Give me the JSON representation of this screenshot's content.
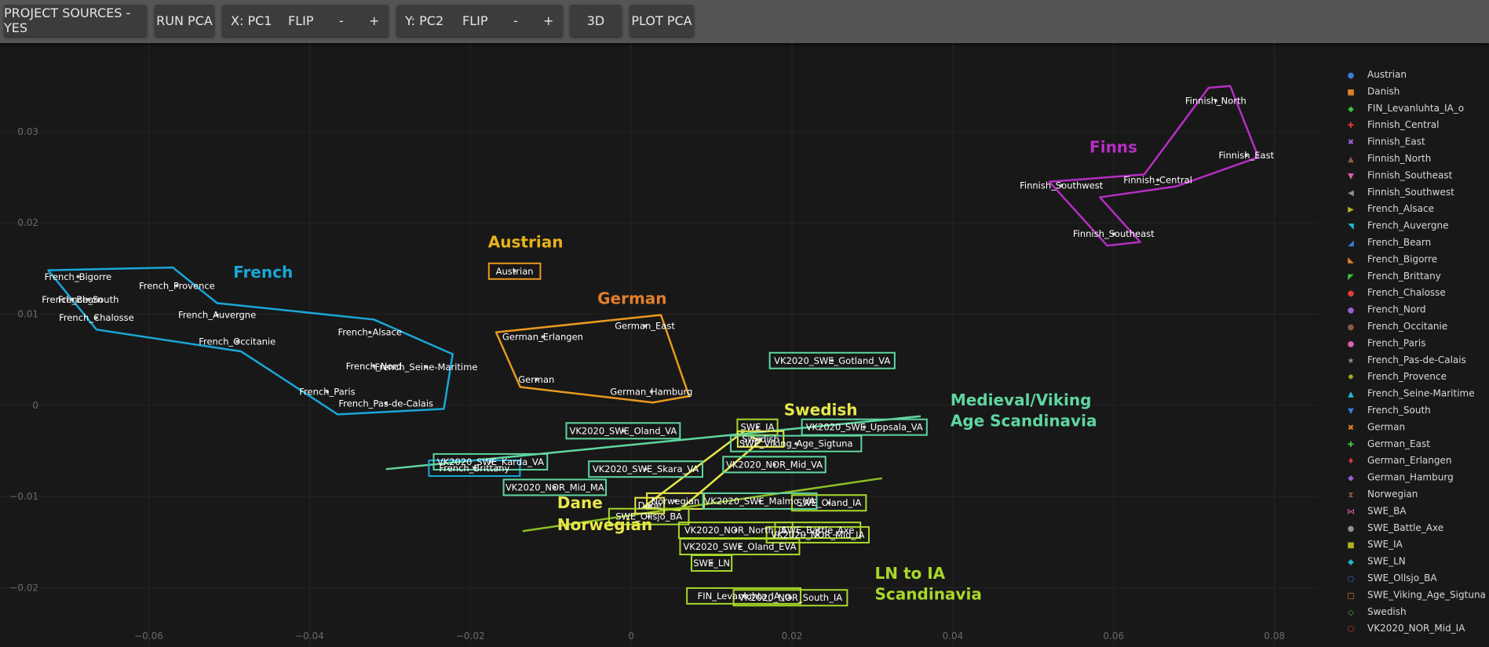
{
  "toolbar": {
    "project_sources": "PROJECT SOURCES - YES",
    "run_pca": "RUN PCA",
    "x_axis": {
      "label": "X: PC1",
      "flip": "FLIP",
      "minus": "-",
      "plus": "+"
    },
    "y_axis": {
      "label": "Y: PC2",
      "flip": "FLIP",
      "minus": "-",
      "plus": "+"
    },
    "three_d": "3D",
    "plot_pca": "PLOT PCA"
  },
  "chart_data": {
    "type": "scatter",
    "xlabel": "",
    "ylabel": "",
    "xlim": [
      -0.0785,
      0.0855
    ],
    "ylim": [
      -0.0265,
      0.0397
    ],
    "xticks": [
      -0.06,
      -0.04,
      -0.02,
      0,
      0.02,
      0.04,
      0.06,
      0.08
    ],
    "xtick_labels": [
      "−0.06",
      "−0.04",
      "−0.02",
      "0",
      "0.02",
      "0.04",
      "0.06",
      "0.08"
    ],
    "yticks": [
      0.03,
      0.02,
      0.01,
      0,
      -0.01,
      -0.02
    ],
    "ytick_labels": [
      "0.03",
      "0.02",
      "0.01",
      "0",
      "−0.01",
      "−0.02"
    ],
    "grid": true,
    "points": [
      {
        "name": "French_Bigorre",
        "x": -0.0688,
        "y": 0.0141
      },
      {
        "name": "French_South",
        "x": -0.0675,
        "y": 0.0116
      },
      {
        "name": "French_Bearn",
        "x": -0.0695,
        "y": 0.0116
      },
      {
        "name": "French_Chalosse",
        "x": -0.0665,
        "y": 0.0096
      },
      {
        "name": "French_Provence",
        "x": -0.0565,
        "y": 0.0131
      },
      {
        "name": "French_Auvergne",
        "x": -0.0515,
        "y": 0.0099
      },
      {
        "name": "French_Occitanie",
        "x": -0.049,
        "y": 0.007
      },
      {
        "name": "French_Alsace",
        "x": -0.0325,
        "y": 0.008
      },
      {
        "name": "French_Nord",
        "x": -0.032,
        "y": 0.0043
      },
      {
        "name": "French_Seine-Maritime",
        "x": -0.0255,
        "y": 0.0042
      },
      {
        "name": "French_Paris",
        "x": -0.0378,
        "y": 0.0015
      },
      {
        "name": "French_Pas-de-Calais",
        "x": -0.0305,
        "y": 0.0002
      },
      {
        "name": "French_Brittany",
        "x": -0.0195,
        "y": -0.0069
      },
      {
        "name": "Austrian",
        "x": -0.0145,
        "y": 0.0147
      },
      {
        "name": "German_Erlangen",
        "x": -0.011,
        "y": 0.0075
      },
      {
        "name": "German_East",
        "x": 0.0017,
        "y": 0.0087
      },
      {
        "name": "German",
        "x": -0.0118,
        "y": 0.0028
      },
      {
        "name": "German_Hamburg",
        "x": 0.0025,
        "y": 0.0015
      },
      {
        "name": "Finnish_North",
        "x": 0.0727,
        "y": 0.0334
      },
      {
        "name": "Finnish_East",
        "x": 0.0765,
        "y": 0.0274
      },
      {
        "name": "Finnish_Central",
        "x": 0.0655,
        "y": 0.0247
      },
      {
        "name": "Finnish_Southwest",
        "x": 0.0535,
        "y": 0.0241
      },
      {
        "name": "Finnish_Southeast",
        "x": 0.06,
        "y": 0.0188
      },
      {
        "name": "VK2020_SWE_Gotland_VA",
        "x": 0.025,
        "y": 0.0049
      },
      {
        "name": "VK2020_SWE_Oland_VA",
        "x": -0.001,
        "y": -0.0028
      },
      {
        "name": "VK2020_SWE_Uppsala_VA",
        "x": 0.029,
        "y": -0.0024
      },
      {
        "name": "SWE_IA",
        "x": 0.0157,
        "y": -0.0024
      },
      {
        "name": "Swedish",
        "x": 0.0161,
        "y": -0.0037
      },
      {
        "name": "SWE_Viking_Age_Sigtuna",
        "x": 0.0205,
        "y": -0.0042
      },
      {
        "name": "VK2020_SWE_Karda_VA",
        "x": -0.0175,
        "y": -0.0062
      },
      {
        "name": "VK2020_SWE_Skara_VA",
        "x": 0.0018,
        "y": -0.007
      },
      {
        "name": "VK2020_NOR_Mid_VA",
        "x": 0.0178,
        "y": -0.0065
      },
      {
        "name": "VK2020_NOR_Mid_MA",
        "x": -0.0095,
        "y": -0.009
      },
      {
        "name": "Dane",
        "x": 0.0023,
        "y": -0.011
      },
      {
        "name": "Norwegian",
        "x": 0.0055,
        "y": -0.0105
      },
      {
        "name": "VK2020_SWE_Malmo_VA",
        "x": 0.016,
        "y": -0.0105
      },
      {
        "name": "SWE_Oland_IA",
        "x": 0.0246,
        "y": -0.0107
      },
      {
        "name": "SWE_Ollsjo_BA",
        "x": 0.0022,
        "y": -0.0122
      },
      {
        "name": "VK2020_NOR_North_IA",
        "x": 0.013,
        "y": -0.0137
      },
      {
        "name": "SWE_Battle_Axe",
        "x": 0.0232,
        "y": -0.0137
      },
      {
        "name": "VK2020_NOR_Mid_IA",
        "x": 0.0232,
        "y": -0.0142
      },
      {
        "name": "VK2020_SWE_Oland_EVA",
        "x": 0.0135,
        "y": -0.0155
      },
      {
        "name": "SWE_LN",
        "x": 0.01,
        "y": -0.0173
      },
      {
        "name": "FIN_Levanluhta_IA_o",
        "x": 0.014,
        "y": -0.0209
      },
      {
        "name": "VK2020_NOR_South_IA",
        "x": 0.0198,
        "y": -0.0211
      }
    ],
    "point_labels": [
      {
        "text": "French_Bigorre",
        "x": -0.0688,
        "y": 0.0141
      },
      {
        "text": "French_South",
        "x": -0.0675,
        "y": 0.0116
      },
      {
        "text": "French_Bearn",
        "x": -0.0695,
        "y": 0.0116
      },
      {
        "text": "French_Chalosse",
        "x": -0.0665,
        "y": 0.0096
      },
      {
        "text": "French_Provence",
        "x": -0.0565,
        "y": 0.0131
      },
      {
        "text": "French_Auvergne",
        "x": -0.0515,
        "y": 0.0099
      },
      {
        "text": "French_Occitanie",
        "x": -0.049,
        "y": 0.007
      },
      {
        "text": "French_Alsace",
        "x": -0.0325,
        "y": 0.008
      },
      {
        "text": "French_Nord",
        "x": -0.032,
        "y": 0.0043
      },
      {
        "text": "French_Seine-Maritime",
        "x": -0.0255,
        "y": 0.0042
      },
      {
        "text": "French_Paris",
        "x": -0.0378,
        "y": 0.0015
      },
      {
        "text": "French_Pas-de-Calais",
        "x": -0.0305,
        "y": 0.0002
      },
      {
        "text": "French_Brittany",
        "x": -0.0195,
        "y": -0.0069,
        "box": "#1aa6d6"
      },
      {
        "text": "Austrian",
        "x": -0.0145,
        "y": 0.0147,
        "box": "#e89a1e"
      },
      {
        "text": "German_Erlangen",
        "x": -0.011,
        "y": 0.0075
      },
      {
        "text": "German_East",
        "x": 0.0017,
        "y": 0.0087
      },
      {
        "text": "German",
        "x": -0.0118,
        "y": 0.0028
      },
      {
        "text": "German_Hamburg",
        "x": 0.0025,
        "y": 0.0015
      },
      {
        "text": "Finnish_North",
        "x": 0.0727,
        "y": 0.0334
      },
      {
        "text": "Finnish_East",
        "x": 0.0765,
        "y": 0.0274
      },
      {
        "text": "Finnish_Central",
        "x": 0.0655,
        "y": 0.0247
      },
      {
        "text": "Finnish_Southwest",
        "x": 0.0535,
        "y": 0.0241
      },
      {
        "text": "Finnish_Southeast",
        "x": 0.06,
        "y": 0.0188
      },
      {
        "text": "VK2020_SWE_Gotland_VA",
        "x": 0.025,
        "y": 0.0049,
        "box": "#5fd6a0"
      },
      {
        "text": "VK2020_SWE_Oland_VA",
        "x": -0.001,
        "y": -0.0028,
        "box": "#5fd6a0"
      },
      {
        "text": "VK2020_SWE_Uppsala_VA",
        "x": 0.029,
        "y": -0.0024,
        "box": "#5fd6a0"
      },
      {
        "text": "SWE_IA",
        "x": 0.0157,
        "y": -0.0024,
        "box": "#a8d82a"
      },
      {
        "text": "Swedish",
        "x": 0.0161,
        "y": -0.0037,
        "box": "#e7e74a"
      },
      {
        "text": "SWE_Viking_Age_Sigtuna",
        "x": 0.0205,
        "y": -0.0042,
        "box": "#5fd6a0"
      },
      {
        "text": "VK2020_SWE_Karda_VA",
        "x": -0.0175,
        "y": -0.0062,
        "box": "#5fd6a0"
      },
      {
        "text": "VK2020_SWE_Skara_VA",
        "x": 0.0018,
        "y": -0.007,
        "box": "#5fd6a0"
      },
      {
        "text": "VK2020_NOR_Mid_VA",
        "x": 0.0178,
        "y": -0.0065,
        "box": "#5fd6a0"
      },
      {
        "text": "VK2020_NOR_Mid_MA",
        "x": -0.0095,
        "y": -0.009,
        "box": "#5fd6a0"
      },
      {
        "text": "Dane",
        "x": 0.0023,
        "y": -0.011,
        "box": "#e7e74a"
      },
      {
        "text": "Norwegian",
        "x": 0.0055,
        "y": -0.0105,
        "box": "#e7e74a"
      },
      {
        "text": "VK2020_SWE_Malmo_VA",
        "x": 0.016,
        "y": -0.0105,
        "box": "#5fd6a0"
      },
      {
        "text": "SWE_Oland_IA",
        "x": 0.0246,
        "y": -0.0107,
        "box": "#a8d82a"
      },
      {
        "text": "SWE_Ollsjo_BA",
        "x": 0.0022,
        "y": -0.0122,
        "box": "#a8d82a"
      },
      {
        "text": "VK2020_NOR_North_IA",
        "x": 0.013,
        "y": -0.0137,
        "box": "#a8d82a"
      },
      {
        "text": "SWE_Battle_Axe",
        "x": 0.0232,
        "y": -0.0137,
        "box": "#a8d82a"
      },
      {
        "text": "VK2020_NOR_Mid_IA",
        "x": 0.0232,
        "y": -0.0142,
        "box": "#a8d82a"
      },
      {
        "text": "VK2020_SWE_Oland_EVA",
        "x": 0.0135,
        "y": -0.0155,
        "box": "#a8d82a"
      },
      {
        "text": "SWE_LN",
        "x": 0.01,
        "y": -0.0173,
        "box": "#a8d82a"
      },
      {
        "text": "FIN_Levanluhta_IA_o",
        "x": 0.014,
        "y": -0.0209,
        "box": "#a8d82a"
      },
      {
        "text": "VK2020_NOR_South_IA",
        "x": 0.0198,
        "y": -0.0211,
        "box": "#a8d82a"
      }
    ],
    "hulls": [
      {
        "color": "#1aa6d6",
        "points": [
          [
            -0.0725,
            0.0148
          ],
          [
            -0.057,
            0.0151
          ],
          [
            -0.0515,
            0.0112
          ],
          [
            -0.032,
            0.0094
          ],
          [
            -0.0222,
            0.0056
          ],
          [
            -0.0233,
            -0.0004
          ],
          [
            -0.0365,
            -0.001
          ],
          [
            -0.0485,
            0.0059
          ],
          [
            -0.0665,
            0.0083
          ]
        ]
      },
      {
        "color": "#e89a1e",
        "points": [
          [
            -0.0168,
            0.008
          ],
          [
            0.0037,
            0.0099
          ],
          [
            0.0072,
            0.001
          ],
          [
            0.0027,
            0.0003
          ],
          [
            -0.0138,
            0.002
          ]
        ]
      },
      {
        "color": "#b62ec4",
        "points": [
          [
            0.052,
            0.0245
          ],
          [
            0.0638,
            0.0253
          ],
          [
            0.0718,
            0.0348
          ],
          [
            0.0745,
            0.035
          ],
          [
            0.078,
            0.0272
          ],
          [
            0.0678,
            0.024
          ],
          [
            0.0583,
            0.0228
          ],
          [
            0.0633,
            0.0179
          ],
          [
            0.0592,
            0.0175
          ],
          [
            0.052,
            0.0245
          ]
        ]
      },
      {
        "color": "#e7e74a",
        "points": [
          [
            0.0138,
            -0.003
          ],
          [
            0.0161,
            -0.0039
          ],
          [
            0.006,
            -0.0115
          ],
          [
            0.0015,
            -0.0112
          ],
          [
            0.0138,
            -0.003
          ]
        ]
      }
    ],
    "lines": [
      {
        "color": "#5fd6a0",
        "from": [
          -0.0305,
          -0.007
        ],
        "to": [
          0.036,
          -0.0012
        ]
      },
      {
        "color": "#8cbf26",
        "from": [
          -0.0135,
          -0.0138
        ],
        "to": [
          0.0312,
          -0.008
        ]
      }
    ],
    "annotations": [
      {
        "text": "French",
        "x": -0.0495,
        "y": 0.014,
        "color": "#1aa6d6"
      },
      {
        "text": "Austrian",
        "x": -0.0178,
        "y": 0.0173,
        "color": "#e8b21e"
      },
      {
        "text": "German",
        "x": -0.0042,
        "y": 0.0111,
        "color": "#e07f2a"
      },
      {
        "text": "Finns",
        "x": 0.057,
        "y": 0.0277,
        "color": "#b62ec4"
      },
      {
        "text": "Swedish",
        "x": 0.019,
        "y": -0.0011,
        "color": "#e7e74a"
      },
      {
        "text": "Dane",
        "x": -0.0092,
        "y": -0.0113,
        "color": "#e7e74a"
      },
      {
        "text": "Norwegian",
        "x": -0.0092,
        "y": -0.0137,
        "color": "#e7e74a"
      },
      {
        "text": "Medieval/Viking",
        "x": 0.0397,
        "y": 0.0,
        "color": "#5fd6a0"
      },
      {
        "text": "Age Scandinavia",
        "x": 0.0397,
        "y": -0.0023,
        "color": "#5fd6a0"
      },
      {
        "text": "LN to IA",
        "x": 0.0303,
        "y": -0.019,
        "color": "#a8d82a"
      },
      {
        "text": "Scandinavia",
        "x": 0.0303,
        "y": -0.0213,
        "color": "#a8d82a"
      }
    ],
    "legend": {
      "placement": "right",
      "entries": [
        {
          "name": "Austrian",
          "marker": "●",
          "color": "#3a7fd6"
        },
        {
          "name": "Danish",
          "marker": "■",
          "color": "#e07f2a"
        },
        {
          "name": "FIN_Levanluhta_IA_o",
          "marker": "◆",
          "color": "#3fbf3f"
        },
        {
          "name": "Finnish_Central",
          "marker": "✚",
          "color": "#e03a3a"
        },
        {
          "name": "Finnish_East",
          "marker": "✖",
          "color": "#9a5ed6"
        },
        {
          "name": "Finnish_North",
          "marker": "▲",
          "color": "#8a5a44"
        },
        {
          "name": "Finnish_Southeast",
          "marker": "▼",
          "color": "#e060b0"
        },
        {
          "name": "Finnish_Southwest",
          "marker": "◀",
          "color": "#909090"
        },
        {
          "name": "French_Alsace",
          "marker": "▶",
          "color": "#b0b020"
        },
        {
          "name": "French_Auvergne",
          "marker": "◥",
          "color": "#20b8d0"
        },
        {
          "name": "French_Bearn",
          "marker": "◢",
          "color": "#3a7fd6"
        },
        {
          "name": "French_Bigorre",
          "marker": "◣",
          "color": "#e07f2a"
        },
        {
          "name": "French_Brittany",
          "marker": "◤",
          "color": "#3fbf3f"
        },
        {
          "name": "French_Chalosse",
          "marker": "●",
          "color": "#e03a3a"
        },
        {
          "name": "French_Nord",
          "marker": "●",
          "color": "#9a5ed6"
        },
        {
          "name": "French_Occitanie",
          "marker": "●",
          "color": "#8a5a44"
        },
        {
          "name": "French_Paris",
          "marker": "●",
          "color": "#e060b0"
        },
        {
          "name": "French_Pas-de-Calais",
          "marker": "★",
          "color": "#909090"
        },
        {
          "name": "French_Provence",
          "marker": "✸",
          "color": "#b0b020"
        },
        {
          "name": "French_Seine-Maritime",
          "marker": "▲",
          "color": "#20b8d0"
        },
        {
          "name": "French_South",
          "marker": "▼",
          "color": "#3a7fd6"
        },
        {
          "name": "German",
          "marker": "✖",
          "color": "#e07f2a"
        },
        {
          "name": "German_East",
          "marker": "✚",
          "color": "#3fbf3f"
        },
        {
          "name": "German_Erlangen",
          "marker": "♦",
          "color": "#e03a3a"
        },
        {
          "name": "German_Hamburg",
          "marker": "◆",
          "color": "#9a5ed6"
        },
        {
          "name": "Norwegian",
          "marker": "⧗",
          "color": "#8a5a44"
        },
        {
          "name": "SWE_BA",
          "marker": "⋈",
          "color": "#e060b0"
        },
        {
          "name": "SWE_Battle_Axe",
          "marker": "●",
          "color": "#909090"
        },
        {
          "name": "SWE_IA",
          "marker": "■",
          "color": "#b0b020"
        },
        {
          "name": "SWE_LN",
          "marker": "◆",
          "color": "#20b8d0"
        },
        {
          "name": "SWE_Ollsjo_BA",
          "marker": "○",
          "color": "#3a7fd6"
        },
        {
          "name": "SWE_Viking_Age_Sigtuna",
          "marker": "□",
          "color": "#e07f2a"
        },
        {
          "name": "Swedish",
          "marker": "◇",
          "color": "#3fbf3f"
        },
        {
          "name": "VK2020_NOR_Mid_IA",
          "marker": "⬡",
          "color": "#e03a3a"
        }
      ]
    }
  }
}
